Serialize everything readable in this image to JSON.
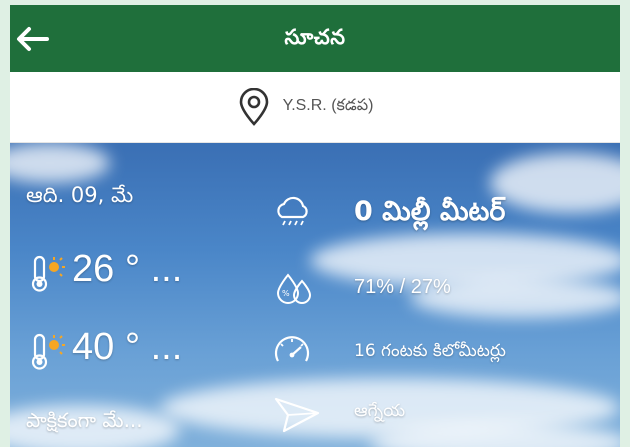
{
  "header": {
    "title": "సూచన",
    "back_icon": "back-arrow-icon"
  },
  "location": {
    "name": "Y.S.R. (కడప)",
    "icon": "location-pin-icon"
  },
  "forecast": {
    "date": "ఆది. 09, మే",
    "temp_min": "26 ° ...",
    "temp_max": "40 ° ...",
    "description": "పాక్షికంగా మే...",
    "rainfall": "0 మిల్లీ మీటర్",
    "humidity": "71% / 27%",
    "wind_speed": "16 గంటకు కిలోమీటర్లు",
    "wind_direction": "ఆగ్నేయ"
  },
  "colors": {
    "header_bg": "#1f6f3b",
    "text_on_sky": "#ffffff"
  }
}
